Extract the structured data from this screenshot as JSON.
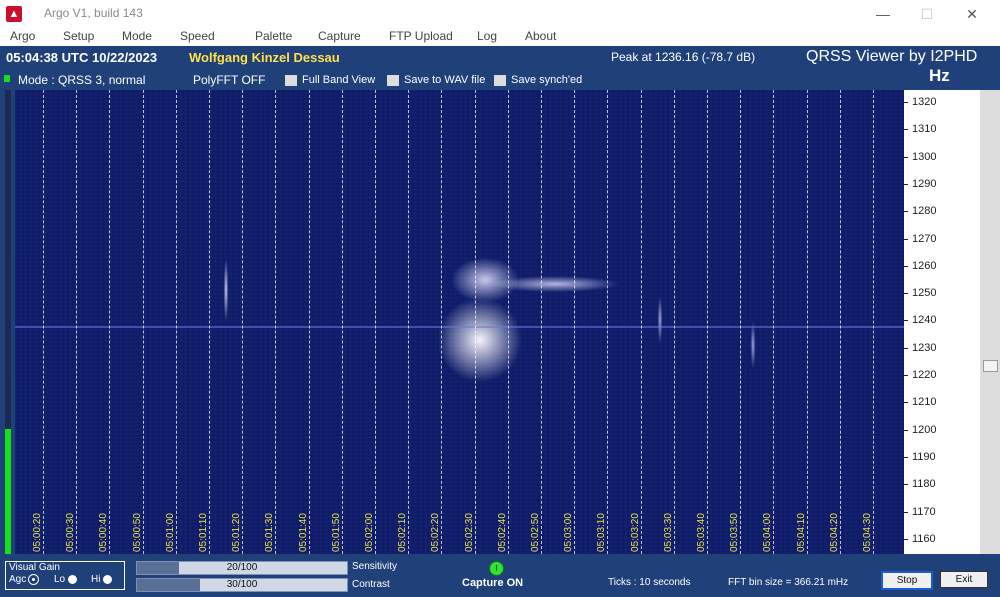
{
  "window": {
    "title": "Argo V1, build 143",
    "minimize": "—",
    "maximize": "☐",
    "close": "✕",
    "icon": "argo-logo-icon"
  },
  "menu": [
    "Argo",
    "Setup",
    "Mode",
    "Speed",
    "Palette",
    "Capture",
    "FTP Upload",
    "Log",
    "About"
  ],
  "header": {
    "time": "05:04:38 UTC  10/22/2023",
    "station": "Wolfgang Kinzel Dessau",
    "peak": "Peak at    1236.16 (-78.7 dB)",
    "brand": "QRSS Viewer by I2PHD",
    "unit": "Hz",
    "mode": "Mode : QRSS 3, normal",
    "polyfft": "PolyFFT OFF",
    "options": [
      "Full Band View",
      "Save to WAV file",
      "Save synch'ed"
    ]
  },
  "freq_axis": [
    "1320",
    "1310",
    "1300",
    "1290",
    "1280",
    "1270",
    "1260",
    "1250",
    "1240",
    "1230",
    "1220",
    "1210",
    "1200",
    "1190",
    "1180",
    "1170",
    "1160"
  ],
  "time_axis": [
    "05:00:20",
    "05:00:30",
    "05:00:40",
    "05:00:50",
    "05:01:00",
    "05:01:10",
    "05:01:20",
    "05:01:30",
    "05:01:40",
    "05:01:50",
    "05:02:00",
    "05:02:10",
    "05:02:20",
    "05:02:30",
    "05:02:40",
    "05:02:50",
    "05:03:00",
    "05:03:10",
    "05:03:20",
    "05:03:30",
    "05:03:40",
    "05:03:50",
    "05:04:00",
    "05:04:10",
    "05:04:20",
    "05:04:30"
  ],
  "bottom": {
    "visual_gain": "Visual Gain",
    "agc": "Agc",
    "lo": "Lo",
    "hi": "Hi",
    "sensitivity_value": "20/100",
    "sensitivity_level": 0.2,
    "sensitivity_label": "Sensitivity",
    "contrast_value": "30/100",
    "contrast_level": 0.3,
    "contrast_label": "Contrast",
    "capture_led": "I",
    "capture": "Capture ON",
    "ticks": "Ticks   : 10 seconds",
    "fft": "FFT bin size = 366.21 mHz",
    "stop": "Stop",
    "exit": "Exit"
  },
  "colors": {
    "panel": "#20407a",
    "station": "#ffe14a",
    "time_labels": "#e8e34a",
    "waterfall": "#0d1a63"
  }
}
